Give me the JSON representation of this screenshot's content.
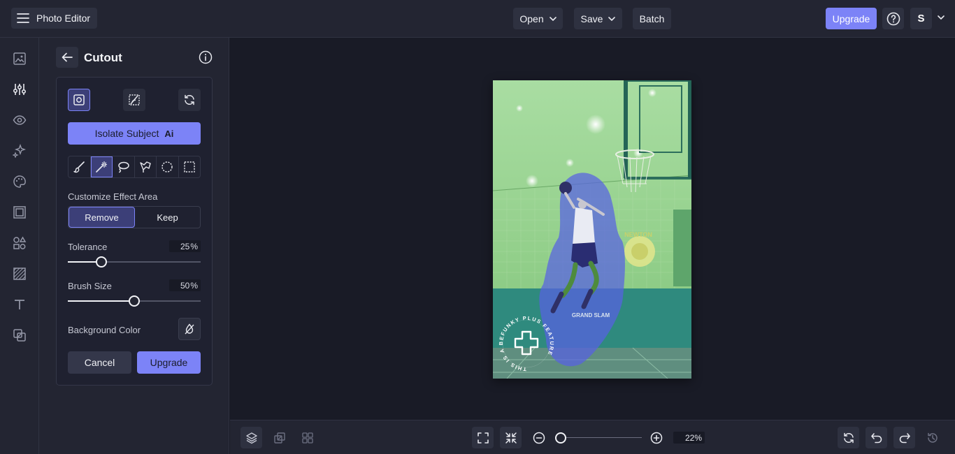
{
  "app": {
    "title": "Photo Editor"
  },
  "topbar": {
    "open_label": "Open",
    "save_label": "Save",
    "batch_label": "Batch",
    "upgrade_label": "Upgrade",
    "avatar_letter": "S"
  },
  "rail": {
    "items": [
      "image-icon",
      "adjust-sliders-icon",
      "eye-icon",
      "sparkle-effects-icon",
      "palette-icon",
      "frame-icon",
      "shapes-icon",
      "texture-icon",
      "text-icon",
      "overlay-icon"
    ],
    "active_index": 1
  },
  "panel": {
    "title": "Cutout",
    "isolate_label": "Isolate Subject",
    "ai_badge": "Ai",
    "tools": [
      "brush-icon",
      "magic-wand-icon",
      "lasso-icon",
      "polygon-lasso-icon",
      "ellipse-select-icon",
      "rect-select-icon"
    ],
    "active_tool": "magic-wand-icon",
    "effect_area_label": "Customize Effect Area",
    "remove_label": "Remove",
    "keep_label": "Keep",
    "active_mode": "Remove",
    "tolerance_label": "Tolerance",
    "tolerance_value": "25",
    "brush_label": "Brush Size",
    "brush_value": "50",
    "percent": "%",
    "bg_color_label": "Background Color",
    "cancel_label": "Cancel",
    "upgrade_label": "Upgrade"
  },
  "photo": {
    "banner_text": "GRAND SLAM",
    "badge_text": "THIS IS A BEFUNKY PLUS FEATURE",
    "colors": {
      "green_overlay": "#8fd68a",
      "blue_mask": "#4c55e0",
      "court_teal": "#2f8a7e"
    }
  },
  "bottombar": {
    "zoom_value": "22",
    "zoom_fraction": 0.0,
    "percent": "%"
  },
  "colors": {
    "accent": "#7c83f7",
    "bg": "#191b26",
    "panel": "#232532"
  }
}
